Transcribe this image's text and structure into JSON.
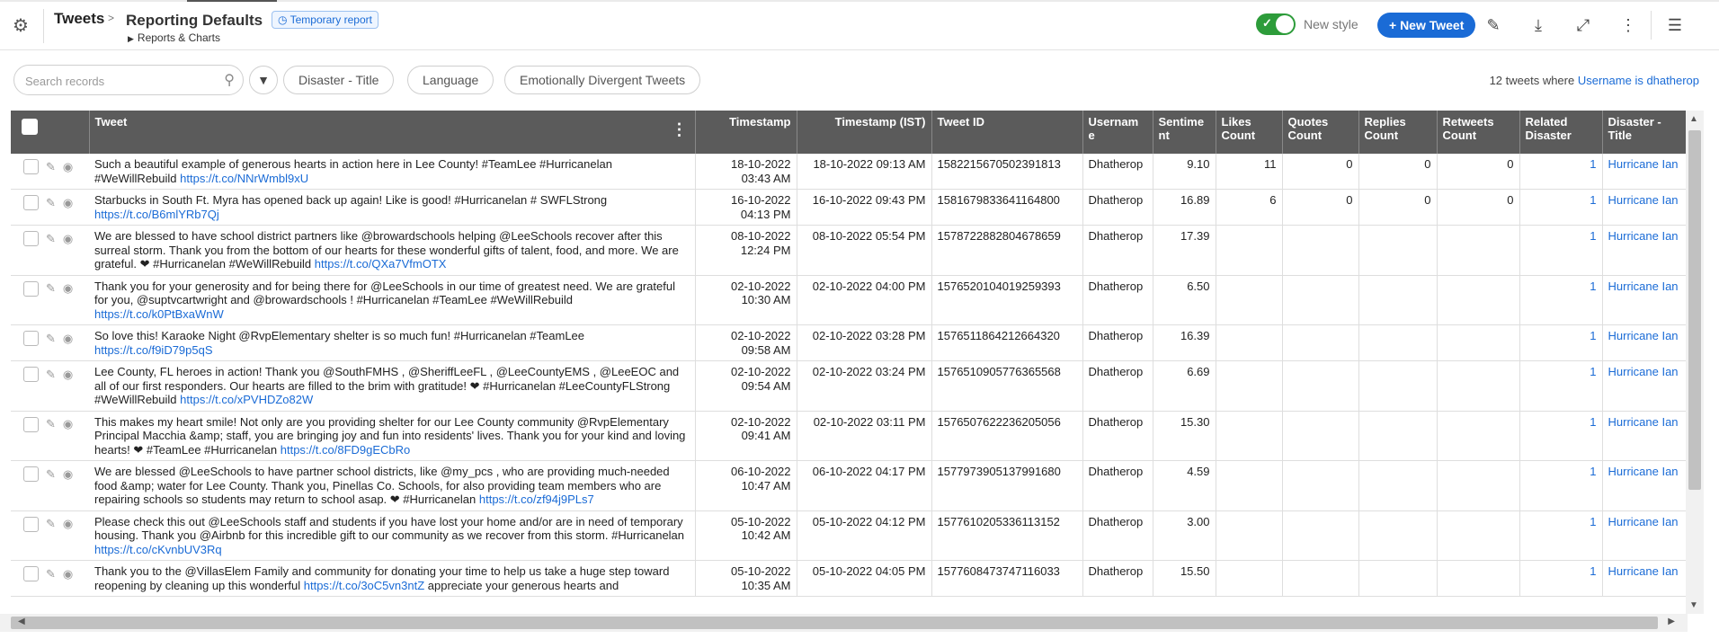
{
  "header": {
    "app_title": "Tweets",
    "report_title": "Reporting Defaults",
    "temp_badge": "Temporary report",
    "sub_crumb": "Reports & Charts",
    "new_style_label": "New style",
    "new_tweet_label": "+ New Tweet",
    "accent": "#1a6bd6",
    "toggle_on_color": "#2d9c3a"
  },
  "filters": {
    "search_placeholder": "Search records",
    "pills": [
      "Disaster - Title",
      "Language",
      "Emotionally Divergent Tweets"
    ],
    "count_prefix": "12 tweets where",
    "count_condition": "Username is dhatherop"
  },
  "table": {
    "columns": [
      "Tweet",
      "Timestamp",
      "Timestamp (IST)",
      "Tweet ID",
      "Usernam e",
      "Sentime nt",
      "Likes Count",
      "Quotes Count",
      "Replies Count",
      "Retweets Count",
      "Related Disaster",
      "Disaster - Title"
    ],
    "rows": [
      {
        "tweet": "Such a beautiful example of generous hearts in action here in Lee County! #TeamLee #Hurricanelan #WeWillRebuild",
        "link": "https://t.co/NNrWmbl9xU",
        "timestamp": "18-10-2022 03:43 AM",
        "timestamp_ist": "18-10-2022 09:13 AM",
        "tweet_id": "1582215670502391813",
        "username": "Dhatherop",
        "sentiment": "9.10",
        "likes": "11",
        "quotes": "0",
        "replies": "0",
        "retweets": "0",
        "related": "1",
        "disaster": "Hurricane Ian"
      },
      {
        "tweet": "Starbucks in South Ft. Myra has opened back up again! Like is good! #Hurricanelan # SWFLStrong",
        "link": "https://t.co/B6mlYRb7Qj",
        "timestamp": "16-10-2022 04:13 PM",
        "timestamp_ist": "16-10-2022 09:43 PM",
        "tweet_id": "1581679833641164800",
        "username": "Dhatherop",
        "sentiment": "16.89",
        "likes": "6",
        "quotes": "0",
        "replies": "0",
        "retweets": "0",
        "related": "1",
        "disaster": "Hurricane Ian"
      },
      {
        "tweet": "We are blessed to have school district partners like @browardschools helping @LeeSchools recover after this surreal storm. Thank you from the bottom of our hearts for these wonderful gifts of talent, food, and more. We are grateful. ❤ #Hurricanelan #WeWillRebuild",
        "link": "https://t.co/QXa7VfmOTX",
        "timestamp": "08-10-2022 12:24 PM",
        "timestamp_ist": "08-10-2022 05:54 PM",
        "tweet_id": "1578722882804678659",
        "username": "Dhatherop",
        "sentiment": "17.39",
        "likes": "",
        "quotes": "",
        "replies": "",
        "retweets": "",
        "related": "1",
        "disaster": "Hurricane Ian"
      },
      {
        "tweet": "Thank you for your generosity and for being there for @LeeSchools in our time of greatest need. We are grateful for you, @suptvcartwright and @browardschools ! #Hurricanelan #TeamLee #WeWillRebuild",
        "link": "https://t.co/k0PtBxaWnW",
        "timestamp": "02-10-2022 10:30 AM",
        "timestamp_ist": "02-10-2022 04:00 PM",
        "tweet_id": "1576520104019259393",
        "username": "Dhatherop",
        "sentiment": "6.50",
        "likes": "",
        "quotes": "",
        "replies": "",
        "retweets": "",
        "related": "1",
        "disaster": "Hurricane Ian"
      },
      {
        "tweet": "So love this! Karaoke Night @RvpElementary shelter is so much fun! #Hurricanelan #TeamLee",
        "link": "https://t.co/f9iD79p5qS",
        "timestamp": "02-10-2022 09:58 AM",
        "timestamp_ist": "02-10-2022 03:28 PM",
        "tweet_id": "1576511864212664320",
        "username": "Dhatherop",
        "sentiment": "16.39",
        "likes": "",
        "quotes": "",
        "replies": "",
        "retweets": "",
        "related": "1",
        "disaster": "Hurricane Ian"
      },
      {
        "tweet": "Lee County, FL heroes in action! Thank you @SouthFMHS , @SheriffLeeFL , @LeeCountyEMS , @LeeEOC and all of our first responders. Our hearts are filled to the brim with gratitude! ❤ #Hurricanelan #LeeCountyFLStrong #WeWillRebuild",
        "link": "https://t.co/xPVHDZo82W",
        "timestamp": "02-10-2022 09:54 AM",
        "timestamp_ist": "02-10-2022 03:24 PM",
        "tweet_id": "1576510905776365568",
        "username": "Dhatherop",
        "sentiment": "6.69",
        "likes": "",
        "quotes": "",
        "replies": "",
        "retweets": "",
        "related": "1",
        "disaster": "Hurricane Ian"
      },
      {
        "tweet": "This makes my heart smile! Not only are you providing shelter for our Lee County community @RvpElementary Principal Macchia &amp; staff, you are bringing joy and fun into residents' lives. Thank you for your kind and loving hearts! ❤ #TeamLee #Hurricanelan",
        "link": "https://t.co/8FD9gECbRo",
        "timestamp": "02-10-2022 09:41 AM",
        "timestamp_ist": "02-10-2022 03:11 PM",
        "tweet_id": "1576507622236205056",
        "username": "Dhatherop",
        "sentiment": "15.30",
        "likes": "",
        "quotes": "",
        "replies": "",
        "retweets": "",
        "related": "1",
        "disaster": "Hurricane Ian"
      },
      {
        "tweet": "We are blessed @LeeSchools to have partner school districts, like @my_pcs , who are providing much-needed food &amp; water for Lee County. Thank you, Pinellas Co. Schools, for also providing team members who are repairing schools so students may return to school asap. ❤ #Hurricanelan",
        "link": "https://t.co/zf94j9PLs7",
        "timestamp": "06-10-2022 10:47 AM",
        "timestamp_ist": "06-10-2022 04:17 PM",
        "tweet_id": "1577973905137991680",
        "username": "Dhatherop",
        "sentiment": "4.59",
        "likes": "",
        "quotes": "",
        "replies": "",
        "retweets": "",
        "related": "1",
        "disaster": "Hurricane Ian"
      },
      {
        "tweet": "Please check this out @LeeSchools staff and students if you have lost your home and/or are in need of temporary housing. Thank you @Airbnb for this incredible gift to our community as we recover from this storm. #Hurricanelan",
        "link": "https://t.co/cKvnbUV3Rq",
        "timestamp": "05-10-2022 10:42 AM",
        "timestamp_ist": "05-10-2022 04:12 PM",
        "tweet_id": "1577610205336113152",
        "username": "Dhatherop",
        "sentiment": "3.00",
        "likes": "",
        "quotes": "",
        "replies": "",
        "retweets": "",
        "related": "1",
        "disaster": "Hurricane Ian"
      },
      {
        "tweet": "Thank you to the @VillasElem Family and community for donating your time to help us take a huge step toward reopening by cleaning up this wonderful",
        "link": "https://t.co/3oC5vn3ntZ",
        "tweet_tail": "appreciate your generous hearts and",
        "timestamp": "05-10-2022 10:35 AM",
        "timestamp_ist": "05-10-2022 04:05 PM",
        "tweet_id": "1577608473747116033",
        "username": "Dhatherop",
        "sentiment": "15.50",
        "likes": "",
        "quotes": "",
        "replies": "",
        "retweets": "",
        "related": "1",
        "disaster": "Hurricane Ian"
      }
    ]
  }
}
